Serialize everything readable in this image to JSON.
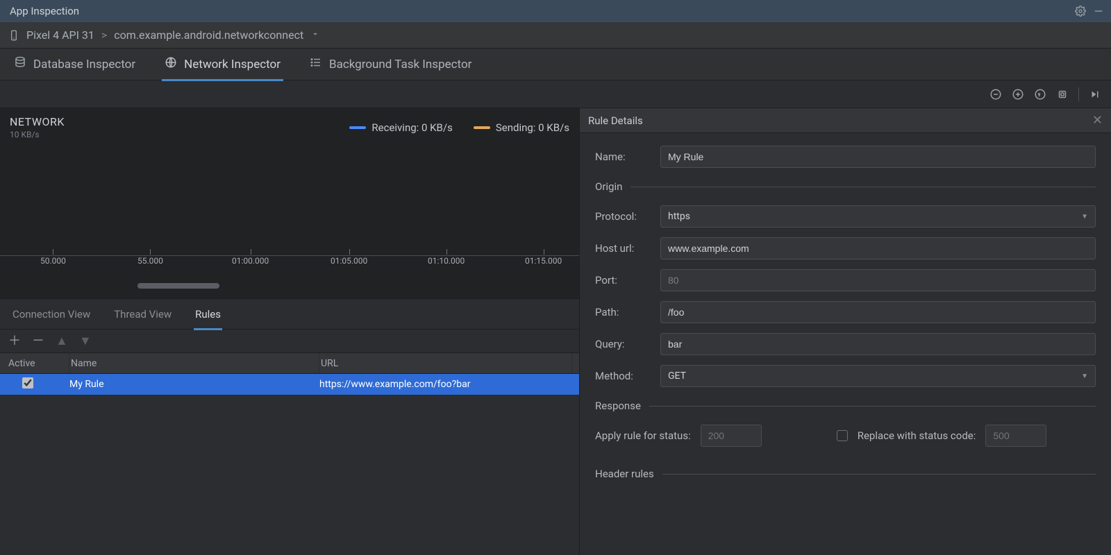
{
  "title": "App Inspection",
  "breadcrumb": {
    "device": "Pixel 4 API 31",
    "sep": ">",
    "pkg": "com.example.android.networkconnect"
  },
  "tabs": {
    "db": "Database Inspector",
    "net": "Network Inspector",
    "bg": "Background Task Inspector"
  },
  "network": {
    "title": "NETWORK",
    "yscale": "10 KB/s",
    "recv_label": "Receiving: 0 KB/s",
    "send_label": "Sending: 0 KB/s",
    "ticks": [
      "50.000",
      "55.000",
      "01:00.000",
      "01:05.000",
      "01:10.000",
      "01:15.000"
    ]
  },
  "subtabs": {
    "conn": "Connection View",
    "thread": "Thread View",
    "rules": "Rules"
  },
  "rules_head": {
    "active": "Active",
    "name": "Name",
    "url": "URL"
  },
  "rule_row": {
    "active": true,
    "name": "My Rule",
    "url": "https://www.example.com/foo?bar"
  },
  "details": {
    "header": "Rule Details",
    "name_label": "Name:",
    "name_value": "My Rule",
    "sections": {
      "origin": "Origin",
      "response": "Response",
      "header_rules": "Header rules"
    },
    "protocol_label": "Protocol:",
    "protocol_value": "https",
    "host_label": "Host url:",
    "host_value": "www.example.com",
    "port_label": "Port:",
    "port_placeholder": "80",
    "path_label": "Path:",
    "path_value": "/foo",
    "query_label": "Query:",
    "query_value": "bar",
    "method_label": "Method:",
    "method_value": "GET",
    "apply_status_label": "Apply rule for status:",
    "apply_status_placeholder": "200",
    "replace_label": "Replace with status code:",
    "replace_placeholder": "500"
  }
}
